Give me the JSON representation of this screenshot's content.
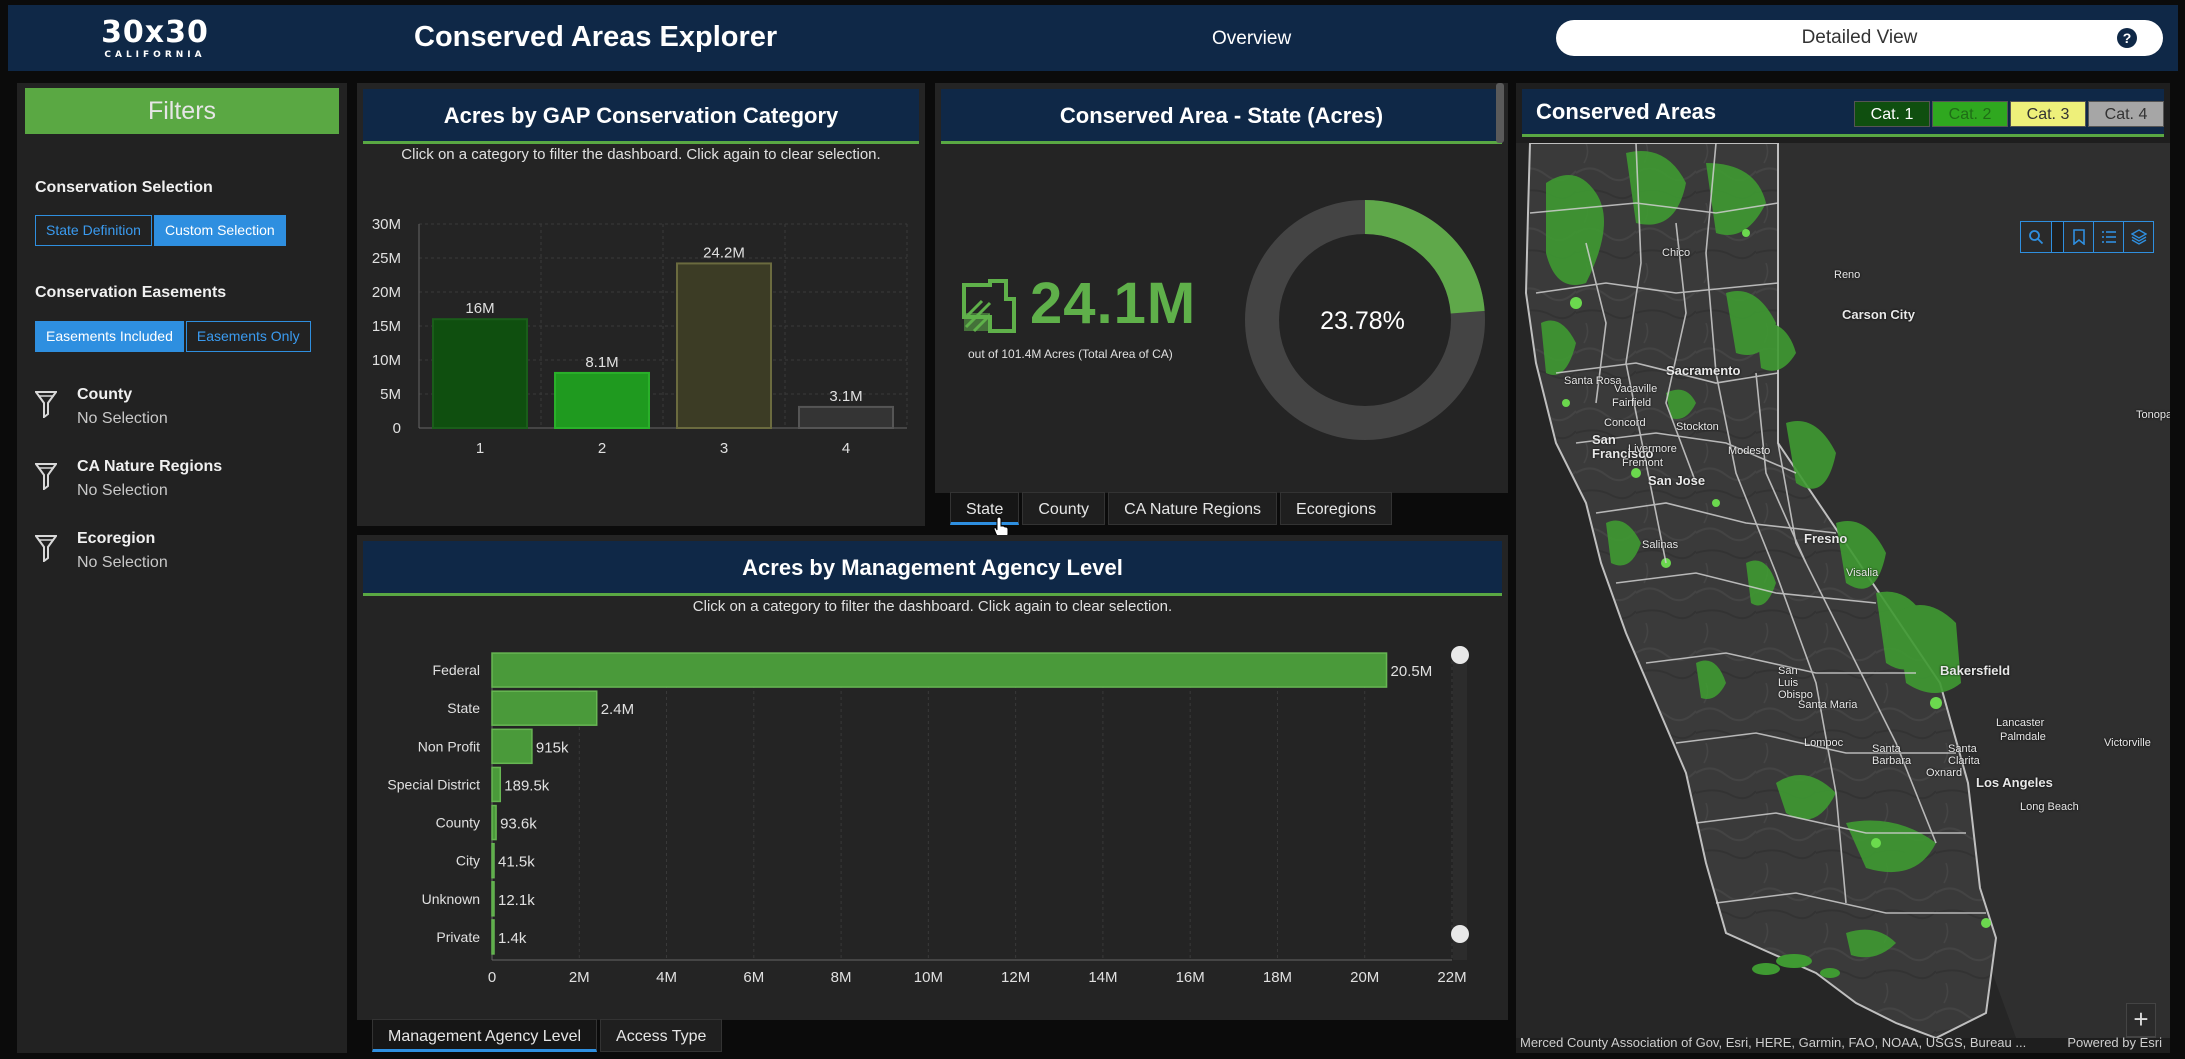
{
  "header": {
    "logo_main": "30x30",
    "logo_sub": "CALIFORNIA",
    "title": "Conserved Areas Explorer",
    "overview_label": "Overview",
    "detailed_label": "Detailed View",
    "help_symbol": "?"
  },
  "filters": {
    "title": "Filters",
    "conservation_selection": {
      "heading": "Conservation Selection",
      "options": [
        "State Definition",
        "Custom Selection"
      ],
      "active": "Custom Selection"
    },
    "conservation_easements": {
      "heading": "Conservation Easements",
      "options": [
        "Easements Included",
        "Easements Only"
      ],
      "active": "Easements Included"
    },
    "items": [
      {
        "name": "County",
        "value": "No Selection",
        "icon": "funnel-icon"
      },
      {
        "name": "CA Nature Regions",
        "value": "No Selection",
        "icon": "funnel-icon"
      },
      {
        "name": "Ecoregion",
        "value": "No Selection",
        "icon": "funnel-icon"
      }
    ]
  },
  "gap_panel": {
    "title": "Acres by GAP Conservation Category",
    "subtitle": "Click on a category to filter the dashboard. Click again to clear selection."
  },
  "state_panel": {
    "title": "Conserved Area - State (Acres)",
    "big_value": "24.1M",
    "sub_value": "out of 101.4M Acres (Total Area of CA)",
    "percent_label": "23.78%",
    "percent": 23.78,
    "tabs": [
      "State",
      "County",
      "CA Nature Regions",
      "Ecoregions"
    ],
    "active_tab": "State"
  },
  "mgmt_panel": {
    "title": "Acres by Management Agency Level",
    "subtitle": "Click on a category to filter the dashboard. Click again to clear selection.",
    "tabs": [
      "Management Agency Level",
      "Access Type"
    ],
    "active_tab": "Management Agency Level"
  },
  "map_panel": {
    "title": "Conserved Areas",
    "categories": [
      {
        "label": "Cat. 1",
        "bg": "#0f4f0f",
        "fg": "#ffffff"
      },
      {
        "label": "Cat. 2",
        "bg": "#2fa81f",
        "fg": "#1f6d16"
      },
      {
        "label": "Cat. 3",
        "bg": "#eef07a",
        "fg": "#333333"
      },
      {
        "label": "Cat. 4",
        "bg": "#a6a6a6",
        "fg": "#333333"
      }
    ],
    "zoom_in": "+",
    "zoom_out": "—",
    "attribution": "Merced County Association of Gov, Esri, HERE, Garmin, FAO, NOAA, USGS, Bureau ...",
    "powered_by": "Powered by Esri",
    "cities": [
      "Chico",
      "Reno",
      "Carson City",
      "Santa Rosa",
      "Sacramento",
      "Vacaville",
      "Fairfield",
      "Concord",
      "Stockton",
      "San Francisco",
      "Livermore",
      "Fremont",
      "Modesto",
      "San Jose",
      "Salinas",
      "Fresno",
      "Visalia",
      "San Luis Obispo",
      "Bakersfield",
      "Santa Maria",
      "Lompoc",
      "Santa Barbara",
      "Lancaster",
      "Palmdale",
      "Victorville",
      "Santa Clarita",
      "Oxnard",
      "Los Angeles",
      "Long Beach",
      "Tonopah"
    ]
  },
  "chart_data": [
    {
      "type": "bar",
      "title": "Acres by GAP Conservation Category",
      "categories": [
        "1",
        "2",
        "3",
        "4"
      ],
      "values": [
        16000000,
        8100000,
        24200000,
        3100000
      ],
      "value_labels": [
        "16M",
        "8.1M",
        "24.2M",
        "3.1M"
      ],
      "colors": [
        "#0f4f0f",
        "#1f9a1f",
        "#3c3c25",
        "#343434"
      ],
      "borders": [
        "#1a5d1a",
        "#2ab02a",
        "#6b6b3f",
        "#555555"
      ],
      "ylim": [
        0,
        30000000
      ],
      "yticks": [
        "0",
        "5M",
        "10M",
        "15M",
        "20M",
        "25M",
        "30M"
      ],
      "grid": true
    },
    {
      "type": "bar",
      "orientation": "horizontal",
      "title": "Acres by Management Agency Level",
      "categories": [
        "Federal",
        "State",
        "Non Profit",
        "Special District",
        "County",
        "City",
        "Unknown",
        "Private"
      ],
      "values": [
        20500000,
        2400000,
        915000,
        189500,
        93600,
        41500,
        12100,
        1400
      ],
      "value_labels": [
        "20.5M",
        "2.4M",
        "915k",
        "189.5k",
        "93.6k",
        "41.5k",
        "12.1k",
        "1.4k"
      ],
      "xlim": [
        0,
        22000000
      ],
      "xticks": [
        "0",
        "2M",
        "4M",
        "6M",
        "8M",
        "10M",
        "12M",
        "14M",
        "16M",
        "18M",
        "20M",
        "22M"
      ],
      "color": "#4a9a3a",
      "grid": true
    }
  ]
}
